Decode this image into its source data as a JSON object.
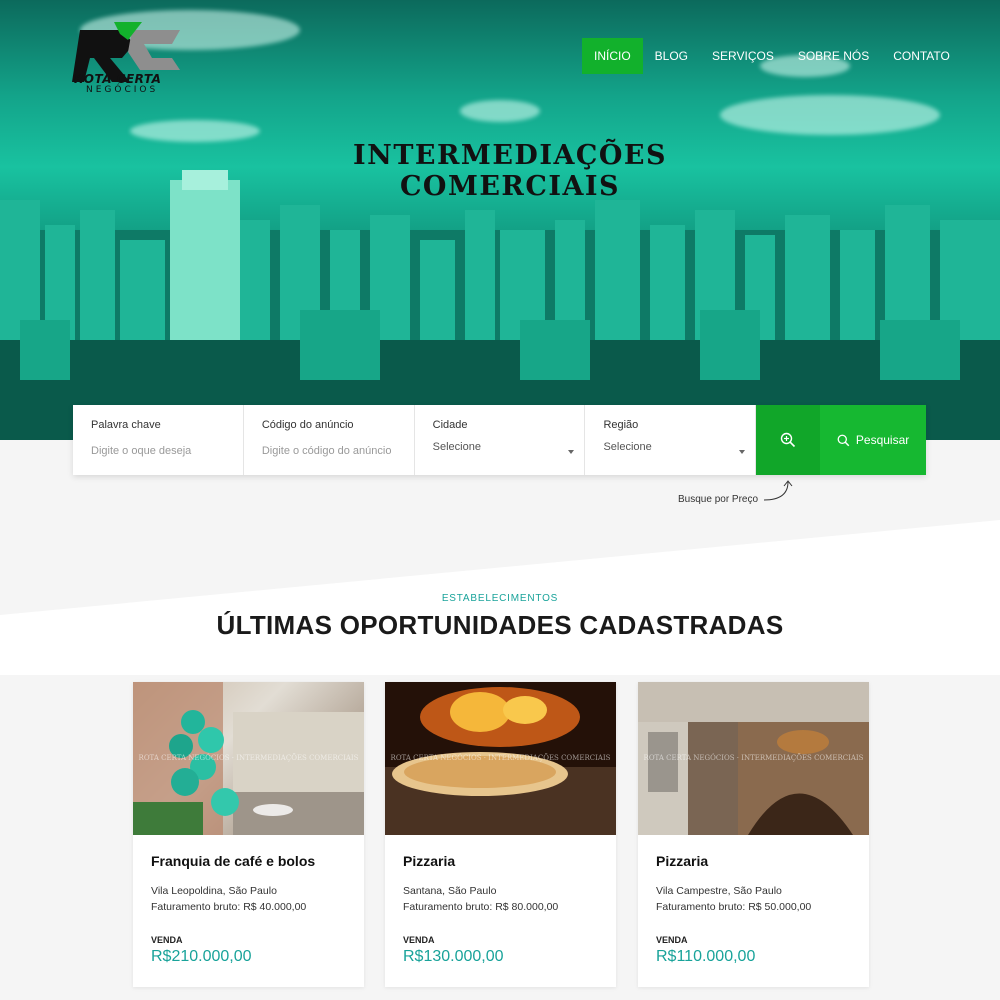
{
  "brand": {
    "name": "ROTA CERTA",
    "sub": "NEGÓCIOS"
  },
  "nav": {
    "items": [
      {
        "label": "INÍCIO",
        "active": true
      },
      {
        "label": "BLOG"
      },
      {
        "label": "SERVIÇOS"
      },
      {
        "label": "SOBRE NÓS"
      },
      {
        "label": "CONTATO"
      }
    ]
  },
  "hero": {
    "line1": "INTERMEDIAÇÕES",
    "line2": "COMERCIAIS"
  },
  "search": {
    "keyword": {
      "label": "Palavra chave",
      "placeholder": "Digite o oque deseja"
    },
    "code": {
      "label": "Código do anúncio",
      "placeholder": "Digite o código do anúncio"
    },
    "city": {
      "label": "Cidade",
      "value": "Selecione"
    },
    "region": {
      "label": "Região",
      "value": "Selecione"
    },
    "advanced_icon": "zoom-plus-icon",
    "button_label": "Pesquisar",
    "price_hint": "Busque por Preço"
  },
  "section": {
    "kicker": "ESTABELECIMENTOS",
    "title": "ÚLTIMAS OPORTUNIDADES CADASTRADAS"
  },
  "watermark": "ROTA CERTA NEGÓCIOS · INTERMEDIAÇÕES COMERCIAIS",
  "listings": [
    {
      "title": "Franquia de café e bolos",
      "location": "Vila Leopoldina, São Paulo",
      "revenue": "Faturamento bruto: R$ 40.000,00",
      "type": "VENDA",
      "price": "R$210.000,00"
    },
    {
      "title": "Pizzaria",
      "location": "Santana, São Paulo",
      "revenue": "Faturamento bruto: R$ 80.000,00",
      "type": "VENDA",
      "price": "R$130.000,00"
    },
    {
      "title": "Pizzaria",
      "location": "Vila Campestre, São Paulo",
      "revenue": "Faturamento bruto: R$ 50.000,00",
      "type": "VENDA",
      "price": "R$110.000,00"
    }
  ],
  "colors": {
    "accent_green": "#12b12c",
    "teal_text": "#19a39a",
    "hero_teal": "#19c2a0"
  }
}
